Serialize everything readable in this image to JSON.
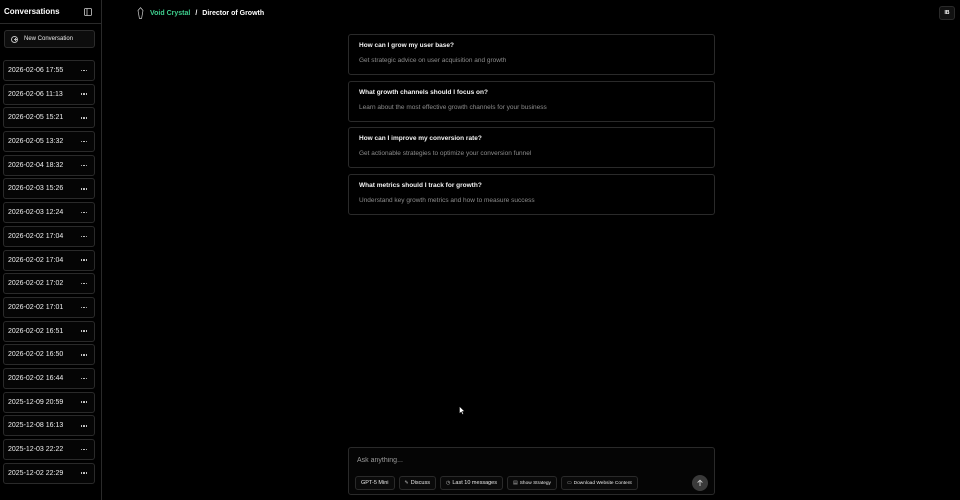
{
  "sidebar": {
    "title": "Conversations",
    "new_conversation_label": "New Conversation",
    "conversations": [
      "2026-02-06 17:55",
      "2026-02-06 11:13",
      "2026-02-05 15:21",
      "2026-02-05 13:32",
      "2026-02-04 18:32",
      "2026-02-03 15:26",
      "2026-02-03 12:24",
      "2026-02-02 17:04",
      "2026-02-02 17:04",
      "2026-02-02 17:02",
      "2026-02-02 17:01",
      "2026-02-02 16:51",
      "2026-02-02 16:50",
      "2026-02-02 16:44",
      "2025-12-09 20:59",
      "2025-12-08 16:13",
      "2025-12-03 22:22",
      "2025-12-02 22:29"
    ]
  },
  "header": {
    "brand_name": "Void Crystal",
    "separator": "/",
    "role": "Director of Growth",
    "badge": "IB"
  },
  "suggestions": [
    {
      "title": "How can I grow my user base?",
      "description": "Get strategic advice on user acquisition and growth"
    },
    {
      "title": "What growth channels should I focus on?",
      "description": "Learn about the most effective growth channels for your business"
    },
    {
      "title": "How can I improve my conversion rate?",
      "description": "Get actionable strategies to optimize your conversion funnel"
    },
    {
      "title": "What metrics should I track for growth?",
      "description": "Understand key growth metrics and how to measure success"
    }
  ],
  "composer": {
    "placeholder": "Ask anything...",
    "model_label": "GPT-5 Mini",
    "discuss_label": "Discuss",
    "history_label": "Last 10 messages",
    "strategy_label": "Show Strategy",
    "download_label": "Download Website Content"
  },
  "colors": {
    "accent": "#3ecf8e",
    "background": "#000000",
    "border": "#2a2a2a"
  }
}
